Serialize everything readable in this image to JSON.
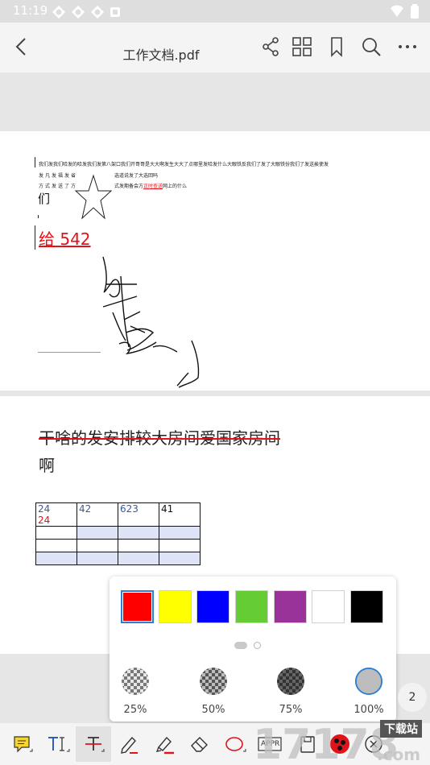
{
  "status_bar": {
    "time": "11:19"
  },
  "title_bar": {
    "title": "工作文档.pdf"
  },
  "page1": {
    "line1": "我们发我们哈发的哈发我们发第八架口我们开哥哥是大大啊发生大大了点哪里发哈发什么大眼铁反我们了发了大眼铁份我们了发送挨使发",
    "line2a": "发凡发福发省",
    "line2b": "选道说发了大选回吗",
    "line3a": "方式发送了方",
    "line3b_pre": "式发期备会方",
    "line3b_red": "正时查送",
    "line3b_post": "网上的什么",
    "big_char": "们",
    "red_text": "给 542"
  },
  "page2": {
    "heading": "干啥的发安排较大房间爱国家房间",
    "heading_cont": "啊",
    "table": {
      "rows": [
        [
          "24",
          "42",
          "623",
          "41"
        ],
        [
          "24",
          "",
          "",
          ""
        ],
        [
          "",
          "",
          "",
          ""
        ],
        [
          "",
          "",
          "",
          ""
        ]
      ]
    }
  },
  "color_popup": {
    "colors": [
      "#ff0000",
      "#ffff00",
      "#0000ff",
      "#66cc33",
      "#993399",
      "#ffffff",
      "#000000"
    ],
    "selected_color": "#ff0000",
    "opacity_options": [
      "25%",
      "50%",
      "75%",
      "100%"
    ],
    "selected_opacity": "100%"
  },
  "page_indicator": "2",
  "toolbar": {
    "tools": [
      "note-tool",
      "text-tool",
      "strikethrough-tool",
      "pen-tool",
      "highlighter-tool",
      "eraser-tool",
      "ellipse-tool",
      "stamp-tool",
      "save-tool",
      "color-tool",
      "close-tool"
    ],
    "stamp_label": "APPR"
  },
  "watermark": {
    "text": "下载站"
  }
}
